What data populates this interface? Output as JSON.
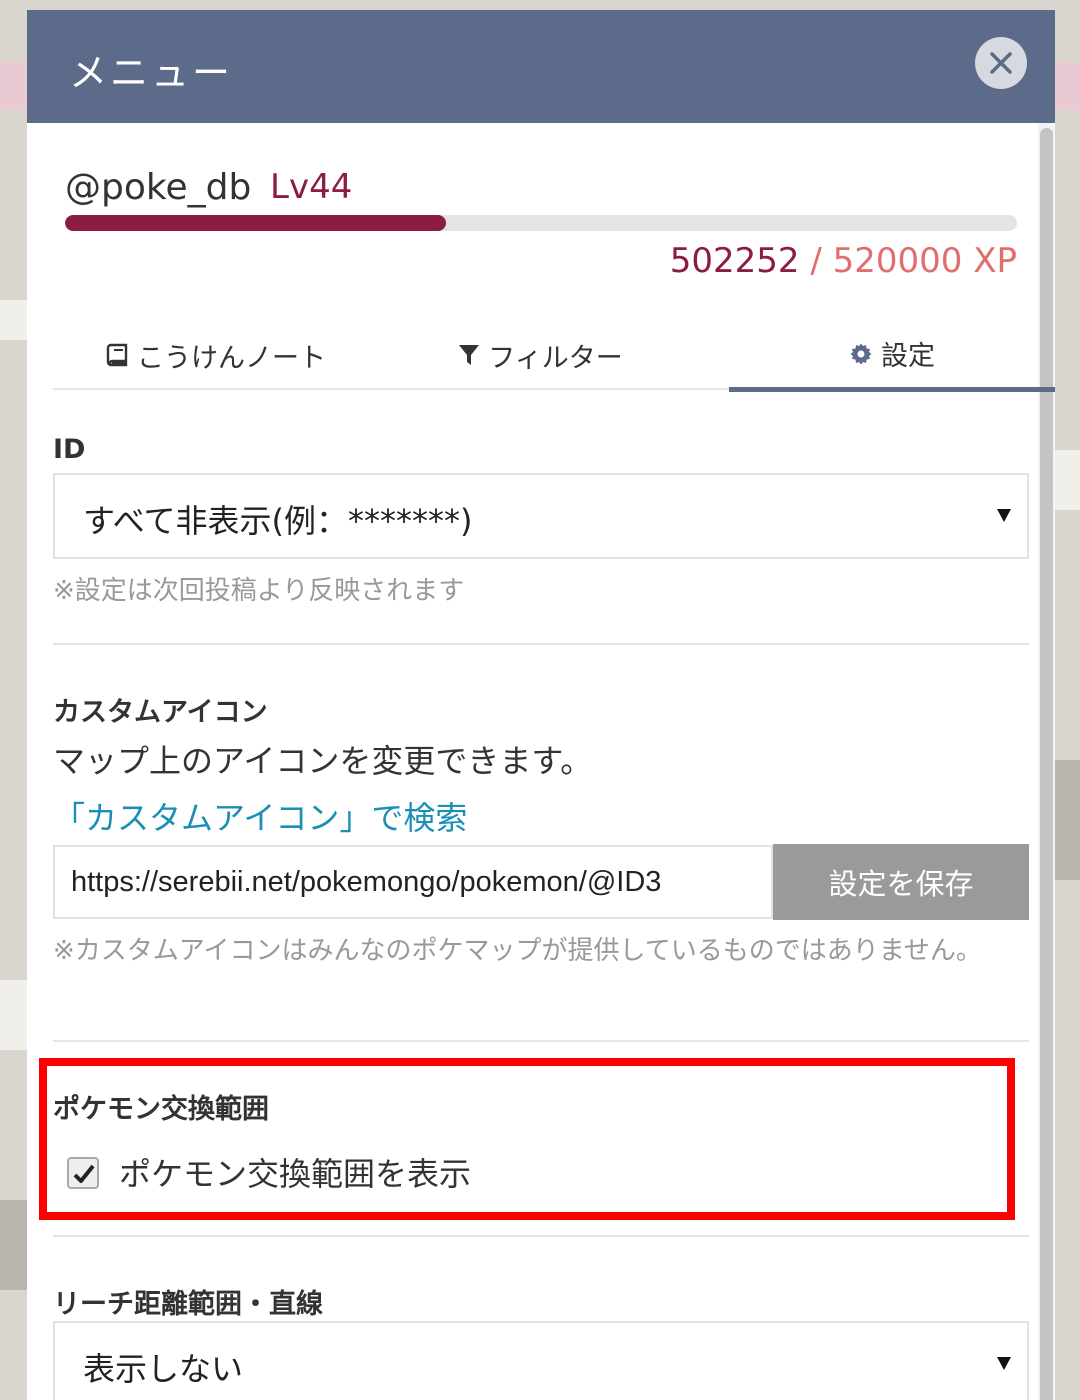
{
  "modal": {
    "title": "メニュー"
  },
  "profile": {
    "username": "@poke_db",
    "level": "Lv44",
    "xp_current": "502252",
    "xp_separator": "/",
    "xp_max": "520000 XP",
    "xp_progress": 0.4
  },
  "tabs": [
    {
      "label": "こうけんノート",
      "icon": "book-icon"
    },
    {
      "label": "フィルター",
      "icon": "filter-icon"
    },
    {
      "label": "設定",
      "icon": "gear-icon",
      "active": true
    }
  ],
  "settings": {
    "id": {
      "label": "ID",
      "selected": "すべて非表示(例：*******)",
      "note": "※設定は次回投稿より反映されます"
    },
    "custom_icon": {
      "label": "カスタムアイコン",
      "description": "マップ上のアイコンを変更できます。",
      "search_link": "「カスタムアイコン」で検索",
      "url_value": "https://serebii.net/pokemongo/pokemon/@ID3",
      "save_label": "設定を保存",
      "note": "※カスタムアイコンはみんなのポケマップが提供しているものではありません。"
    },
    "trade_range": {
      "label": "ポケモン交換範囲",
      "checkbox_label": "ポケモン交換範囲を表示",
      "checked": true
    },
    "reach_range": {
      "label": "リーチ距離範囲・直線",
      "selected": "表示しない"
    }
  },
  "colors": {
    "header": "#5c6b8a",
    "accent": "#8b1e3f",
    "link": "#1a8fb5",
    "highlight": "#ff0000"
  }
}
